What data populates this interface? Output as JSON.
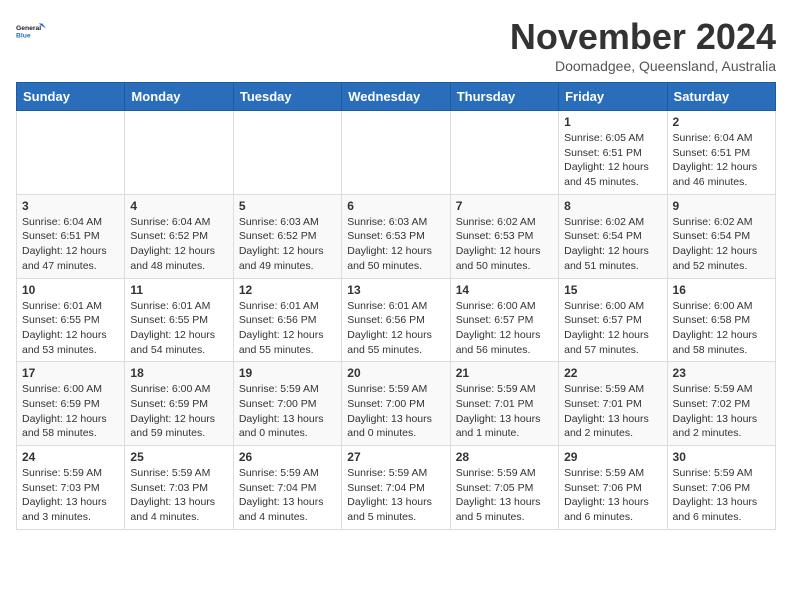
{
  "logo": {
    "line1": "General",
    "line2": "Blue"
  },
  "title": "November 2024",
  "subtitle": "Doomadgee, Queensland, Australia",
  "headers": [
    "Sunday",
    "Monday",
    "Tuesday",
    "Wednesday",
    "Thursday",
    "Friday",
    "Saturday"
  ],
  "weeks": [
    [
      {
        "day": "",
        "content": ""
      },
      {
        "day": "",
        "content": ""
      },
      {
        "day": "",
        "content": ""
      },
      {
        "day": "",
        "content": ""
      },
      {
        "day": "",
        "content": ""
      },
      {
        "day": "1",
        "content": "Sunrise: 6:05 AM\nSunset: 6:51 PM\nDaylight: 12 hours\nand 45 minutes."
      },
      {
        "day": "2",
        "content": "Sunrise: 6:04 AM\nSunset: 6:51 PM\nDaylight: 12 hours\nand 46 minutes."
      }
    ],
    [
      {
        "day": "3",
        "content": "Sunrise: 6:04 AM\nSunset: 6:51 PM\nDaylight: 12 hours\nand 47 minutes."
      },
      {
        "day": "4",
        "content": "Sunrise: 6:04 AM\nSunset: 6:52 PM\nDaylight: 12 hours\nand 48 minutes."
      },
      {
        "day": "5",
        "content": "Sunrise: 6:03 AM\nSunset: 6:52 PM\nDaylight: 12 hours\nand 49 minutes."
      },
      {
        "day": "6",
        "content": "Sunrise: 6:03 AM\nSunset: 6:53 PM\nDaylight: 12 hours\nand 50 minutes."
      },
      {
        "day": "7",
        "content": "Sunrise: 6:02 AM\nSunset: 6:53 PM\nDaylight: 12 hours\nand 50 minutes."
      },
      {
        "day": "8",
        "content": "Sunrise: 6:02 AM\nSunset: 6:54 PM\nDaylight: 12 hours\nand 51 minutes."
      },
      {
        "day": "9",
        "content": "Sunrise: 6:02 AM\nSunset: 6:54 PM\nDaylight: 12 hours\nand 52 minutes."
      }
    ],
    [
      {
        "day": "10",
        "content": "Sunrise: 6:01 AM\nSunset: 6:55 PM\nDaylight: 12 hours\nand 53 minutes."
      },
      {
        "day": "11",
        "content": "Sunrise: 6:01 AM\nSunset: 6:55 PM\nDaylight: 12 hours\nand 54 minutes."
      },
      {
        "day": "12",
        "content": "Sunrise: 6:01 AM\nSunset: 6:56 PM\nDaylight: 12 hours\nand 55 minutes."
      },
      {
        "day": "13",
        "content": "Sunrise: 6:01 AM\nSunset: 6:56 PM\nDaylight: 12 hours\nand 55 minutes."
      },
      {
        "day": "14",
        "content": "Sunrise: 6:00 AM\nSunset: 6:57 PM\nDaylight: 12 hours\nand 56 minutes."
      },
      {
        "day": "15",
        "content": "Sunrise: 6:00 AM\nSunset: 6:57 PM\nDaylight: 12 hours\nand 57 minutes."
      },
      {
        "day": "16",
        "content": "Sunrise: 6:00 AM\nSunset: 6:58 PM\nDaylight: 12 hours\nand 58 minutes."
      }
    ],
    [
      {
        "day": "17",
        "content": "Sunrise: 6:00 AM\nSunset: 6:59 PM\nDaylight: 12 hours\nand 58 minutes."
      },
      {
        "day": "18",
        "content": "Sunrise: 6:00 AM\nSunset: 6:59 PM\nDaylight: 12 hours\nand 59 minutes."
      },
      {
        "day": "19",
        "content": "Sunrise: 5:59 AM\nSunset: 7:00 PM\nDaylight: 13 hours\nand 0 minutes."
      },
      {
        "day": "20",
        "content": "Sunrise: 5:59 AM\nSunset: 7:00 PM\nDaylight: 13 hours\nand 0 minutes."
      },
      {
        "day": "21",
        "content": "Sunrise: 5:59 AM\nSunset: 7:01 PM\nDaylight: 13 hours\nand 1 minute."
      },
      {
        "day": "22",
        "content": "Sunrise: 5:59 AM\nSunset: 7:01 PM\nDaylight: 13 hours\nand 2 minutes."
      },
      {
        "day": "23",
        "content": "Sunrise: 5:59 AM\nSunset: 7:02 PM\nDaylight: 13 hours\nand 2 minutes."
      }
    ],
    [
      {
        "day": "24",
        "content": "Sunrise: 5:59 AM\nSunset: 7:03 PM\nDaylight: 13 hours\nand 3 minutes."
      },
      {
        "day": "25",
        "content": "Sunrise: 5:59 AM\nSunset: 7:03 PM\nDaylight: 13 hours\nand 4 minutes."
      },
      {
        "day": "26",
        "content": "Sunrise: 5:59 AM\nSunset: 7:04 PM\nDaylight: 13 hours\nand 4 minutes."
      },
      {
        "day": "27",
        "content": "Sunrise: 5:59 AM\nSunset: 7:04 PM\nDaylight: 13 hours\nand 5 minutes."
      },
      {
        "day": "28",
        "content": "Sunrise: 5:59 AM\nSunset: 7:05 PM\nDaylight: 13 hours\nand 5 minutes."
      },
      {
        "day": "29",
        "content": "Sunrise: 5:59 AM\nSunset: 7:06 PM\nDaylight: 13 hours\nand 6 minutes."
      },
      {
        "day": "30",
        "content": "Sunrise: 5:59 AM\nSunset: 7:06 PM\nDaylight: 13 hours\nand 6 minutes."
      }
    ]
  ]
}
